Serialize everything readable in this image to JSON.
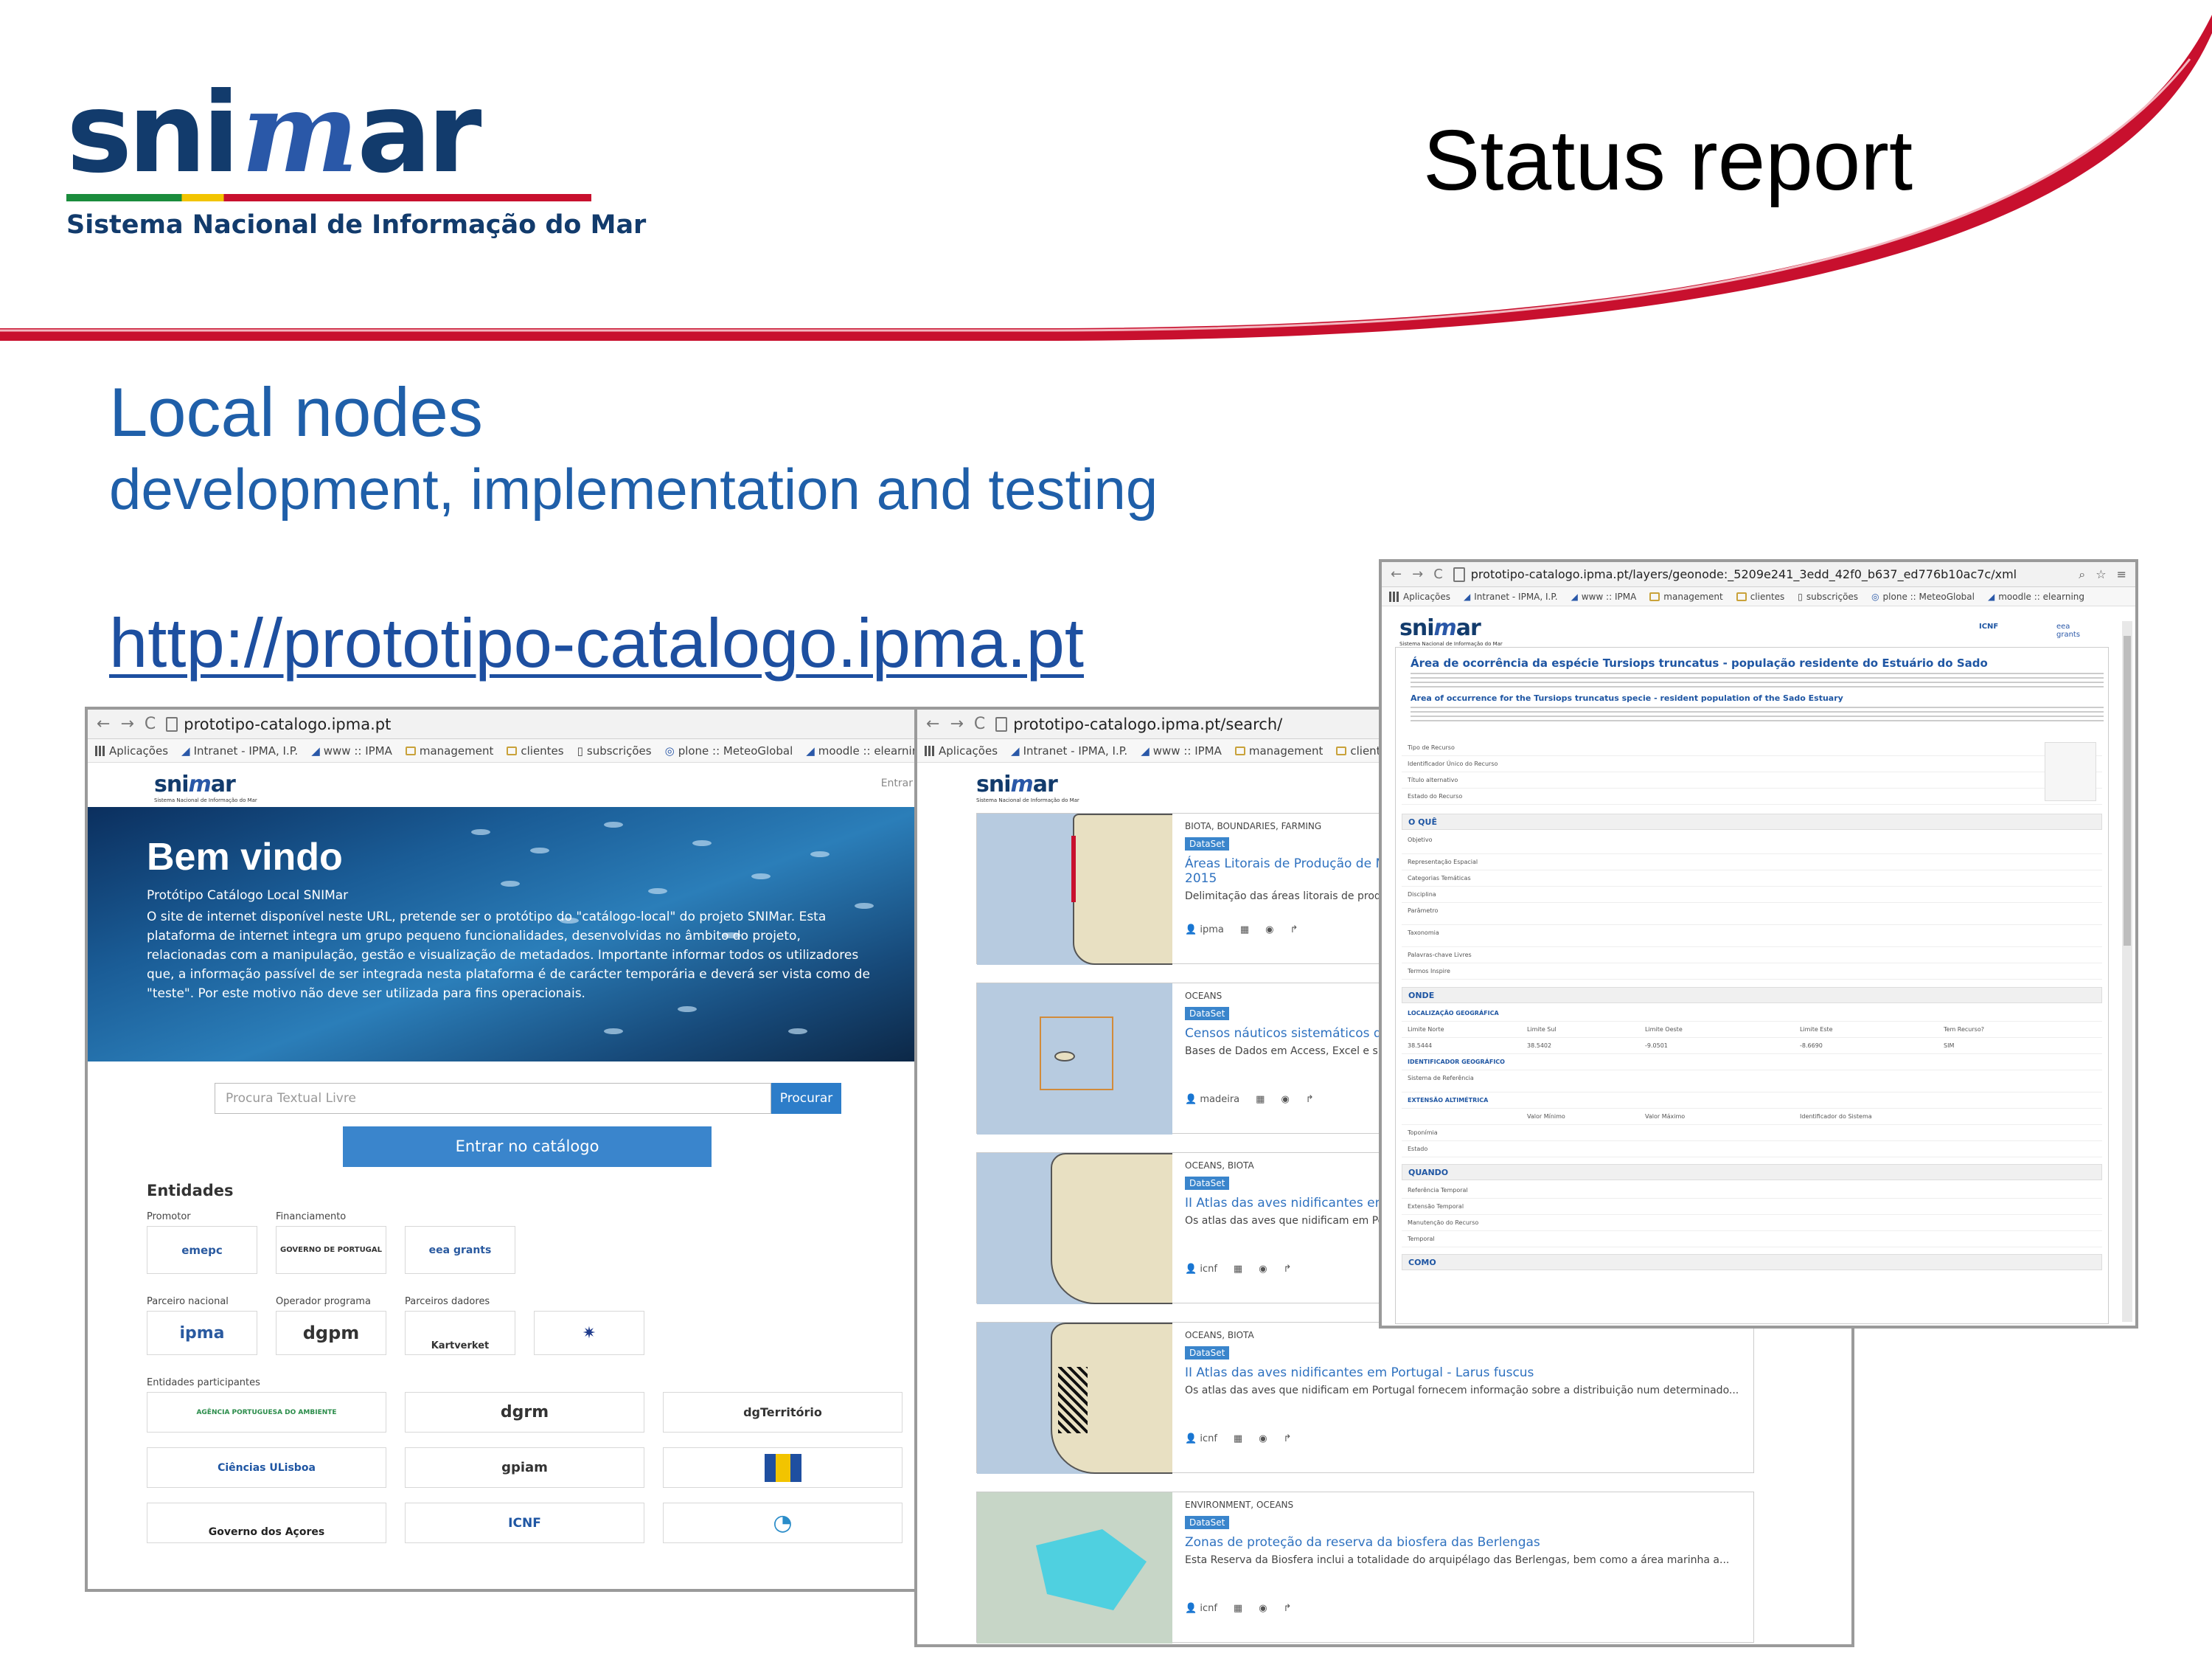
{
  "slide": {
    "logo_word_left": "sni",
    "logo_word_mid": "m",
    "logo_word_right": "ar",
    "logo_tagline": "Sistema Nacional de Informação do Mar",
    "title": "Status report",
    "heading": "Local nodes",
    "subheading": "development, implementation and testing",
    "url": "http://prototipo-catalogo.ipma.pt"
  },
  "colors": {
    "accent": "#1f5fa9",
    "swoosh": "#c8102e",
    "brand": "#123b6c",
    "button": "#3a85cc"
  },
  "bookmarks": [
    "Aplicações",
    "Intranet - IPMA, I.P.",
    "www :: IPMA",
    "management",
    "clientes",
    "subscrições",
    "plone :: MeteoGlobal",
    "moodle :: elearning"
  ],
  "win1": {
    "url": "prototipo-catalogo.ipma.pt",
    "login": "Entrar",
    "welcome": "Bem vindo",
    "sub": "Protótipo Catálogo Local SNIMar",
    "body": "O site de internet disponível neste URL, pretende ser o protótipo do \"catálogo-local\" do projeto SNIMar. Esta plataforma de internet integra um grupo pequeno funcionalidades, desenvolvidas no âmbito do projeto, relacionadas com a manipulação, gestão e visualização de metadados. Importante informar todos os utilizadores que, a informação passível de ser integrada nesta plataforma é de carácter temporária e deverá ser vista como de \"teste\". Por este motivo não deve ser utilizada para fins operacionais.",
    "search_placeholder": "Procura Textual Livre",
    "search_btn": "Procurar",
    "enter_btn": "Entrar no catálogo",
    "entities": "Entidades",
    "promotor": "Promotor",
    "financiamento": "Financiamento",
    "parceiro_nacional": "Parceiro nacional",
    "operador": "Operador programa",
    "parceiros_dadores": "Parceiros dadores",
    "participantes": "Entidades participantes",
    "logos": {
      "emepc": "emepc",
      "governo": "GOVERNO DE PORTUGAL",
      "eea": "eea grants",
      "ipma": "ipma",
      "dgpm": "dgpm",
      "kartverket": "Kartverket",
      "apa": "AGÊNCIA PORTUGUESA DO AMBIENTE",
      "dgrm": "dgrm",
      "dgterritorio": "dgTerritório",
      "ciencias": "Ciências ULisboa",
      "gpiam": "gpiam",
      "acores": "Governo dos Açores",
      "icnf": "ICNF"
    }
  },
  "win2": {
    "url": "prototipo-catalogo.ipma.pt/search/",
    "client": "client",
    "results": [
      {
        "cat": "BIOTA, BOUNDARIES, FARMING",
        "badge": "DataSet",
        "title": "Áreas Litorais de Produção de Mol",
        "title2": "2015",
        "desc": "Delimitação das áreas litorais de produção de",
        "owner": "ipma"
      },
      {
        "cat": "OCEANS",
        "badge": "DataSet",
        "title": "Censos náuticos sistemáticos do M",
        "desc": "Bases de Dados em Access, Excel e shapefiles",
        "owner": "madeira"
      },
      {
        "cat": "OCEANS, BIOTA",
        "badge": "DataSet",
        "title": "II Atlas das aves nidificantes em Po",
        "desc": "Os atlas das aves que nidificam em Portugal f",
        "owner": "icnf"
      },
      {
        "cat": "OCEANS, BIOTA",
        "badge": "DataSet",
        "title": "II Atlas das aves nidificantes em Portugal - Larus fuscus",
        "desc": "Os atlas das aves que nidificam em Portugal fornecem informação sobre a distribuição num determinado...",
        "owner": "icnf"
      },
      {
        "cat": "ENVIRONMENT, OCEANS",
        "badge": "DataSet",
        "title": "Zonas de proteção da reserva da biosfera das Berlengas",
        "desc": "Esta Reserva da Biosfera inclui a totalidade do arquipélago das Berlengas, bem como a área marinha a...",
        "owner": "icnf"
      }
    ]
  },
  "win3": {
    "url": "prototipo-catalogo.ipma.pt/layers/geonode:_5209e241_3edd_42f0_b637_ed776b10ac7c/xml",
    "title_pt": "Área de ocorrência da espécie Tursiops truncatus - população residente do Estuário do Sado",
    "title_en": "Area of occurrence for the Tursiops truncatus specie - resident population of the Sado Estuary",
    "sec_what": "O QUÊ",
    "sec_where": "ONDE",
    "sec_when": "QUANDO",
    "sec_how": "COMO",
    "rows_top": [
      "Tipo de Recurso",
      "Identificador Único do Recurso",
      "Título alternativo",
      "Estado do Recurso"
    ],
    "rows_what": [
      "Objetivo",
      "Representação Espacial",
      "Categorias Temáticas",
      "Disciplina",
      "Parâmetro",
      "Taxonomia",
      "Palavras-chave Livres",
      "Termos Inspire"
    ],
    "geo": "LOCALIZAÇÃO GEOGRÁFICA",
    "geo_cols": [
      "Limite Norte",
      "Limite Sul",
      "Limite Oeste",
      "Limite Este",
      "Tem Recurso?"
    ],
    "geo_vals": [
      "38.5444",
      "38.5402",
      "-9.0501",
      "-8.6690",
      "SIM"
    ],
    "id_geo": "IDENTIFICADOR GEOGRÁFICO",
    "ref": "Sistema de Referência",
    "ext_alt": "EXTENSÃO ALTIMÉTRICA",
    "alt_cols": [
      "Valor Mínimo",
      "Valor Máximo",
      "Identificador do Sistema"
    ],
    "topo": "Toponímia",
    "estado": "Estado",
    "when_rows": [
      "Referência Temporal",
      "Extensão Temporal",
      "Manutenção do Recurso",
      "Temporal"
    ]
  }
}
